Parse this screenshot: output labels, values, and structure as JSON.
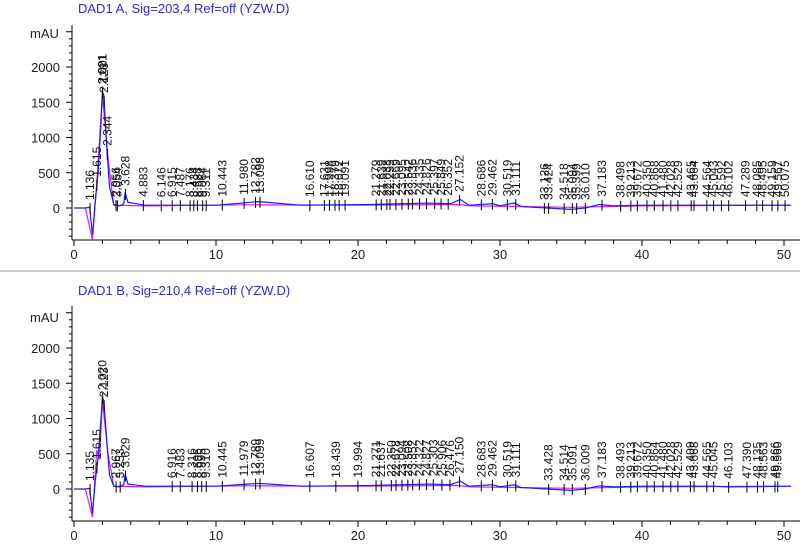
{
  "chart_data": [
    {
      "type": "line",
      "title": "DAD1 A, Sig=203,4 Ref=off (YZW.D)",
      "ylabel": "mAU",
      "xlabel": "",
      "xlim": [
        0,
        50.5
      ],
      "ylim": [
        -500,
        2700
      ],
      "x_ticks": [
        0,
        10,
        20,
        30,
        40,
        50
      ],
      "y_ticks": [
        0,
        500,
        1000,
        1500,
        2000
      ],
      "colors": {
        "signal": "#1a1aff",
        "baseline": "#e020e0"
      },
      "series": [
        {
          "name": "signal",
          "points": [
            [
              0,
              0
            ],
            [
              0.8,
              0
            ],
            [
              1.1,
              10
            ],
            [
              1.3,
              -380
            ],
            [
              1.5,
              100
            ],
            [
              1.7,
              500
            ],
            [
              1.9,
              1200
            ],
            [
              2.0,
              1650
            ],
            [
              2.1,
              1600
            ],
            [
              2.3,
              900
            ],
            [
              2.5,
              300
            ],
            [
              2.8,
              50
            ],
            [
              3.2,
              30
            ],
            [
              3.5,
              60
            ],
            [
              3.6,
              220
            ],
            [
              3.8,
              80
            ],
            [
              5,
              40
            ],
            [
              10,
              40
            ],
            [
              13,
              90
            ],
            [
              16,
              40
            ],
            [
              21,
              50
            ],
            [
              25,
              70
            ],
            [
              26.5,
              60
            ],
            [
              27.2,
              120
            ],
            [
              27.8,
              40
            ],
            [
              29.5,
              60
            ],
            [
              30,
              30
            ],
            [
              31,
              70
            ],
            [
              31.5,
              20
            ],
            [
              35,
              -20
            ],
            [
              36,
              0
            ],
            [
              37,
              50
            ],
            [
              38,
              30
            ],
            [
              40,
              40
            ],
            [
              50.5,
              40
            ]
          ]
        },
        {
          "name": "baseline",
          "points": [
            [
              0.8,
              0
            ],
            [
              1.3,
              -450
            ],
            [
              1.6,
              350
            ],
            [
              2.0,
              1600
            ],
            [
              2.4,
              700
            ],
            [
              2.8,
              40
            ],
            [
              5,
              30
            ],
            [
              12,
              45
            ],
            [
              20,
              40
            ],
            [
              27,
              50
            ],
            [
              28,
              30
            ],
            [
              35,
              10
            ],
            [
              40,
              30
            ],
            [
              50.5,
              40
            ]
          ]
        }
      ],
      "peak_labels": [
        "1.136",
        "1.615",
        "2.001",
        "2.021",
        "2.123",
        "2.344",
        "2.956",
        "3.054",
        "3.628",
        "4.883",
        "6.146",
        "6.915",
        "7.487",
        "8.176",
        "8.434",
        "8.688",
        "9.064",
        "9.311",
        "10.443",
        "11.980",
        "12.782",
        "13.098",
        "16.610",
        "17.631",
        "17.998",
        "18.379",
        "18.672",
        "19.091",
        "21.279",
        "21.639",
        "22.033",
        "22.255",
        "22.669",
        "23.095",
        "23.542",
        "23.836",
        "24.335",
        "24.826",
        "25.397",
        "25.849",
        "26.352",
        "27.152",
        "28.686",
        "29.462",
        "30.519",
        "31.111",
        "33.126",
        "33.424",
        "34.518",
        "35.094",
        "35.399",
        "36.010",
        "37.183",
        "38.498",
        "39.213",
        "39.672",
        "40.350",
        "40.868",
        "41.480",
        "42.028",
        "42.529",
        "43.465",
        "43.664",
        "44.564",
        "45.043",
        "45.592",
        "46.102",
        "47.289",
        "48.085",
        "48.495",
        "49.159",
        "49.567",
        "50.075"
      ]
    },
    {
      "type": "line",
      "title": "DAD1 B, Sig=210,4 Ref=off (YZW.D)",
      "ylabel": "mAU",
      "xlabel": "",
      "xlim": [
        0,
        50.5
      ],
      "ylim": [
        -500,
        2700
      ],
      "x_ticks": [
        0,
        10,
        20,
        30,
        40,
        50
      ],
      "y_ticks": [
        0,
        500,
        1000,
        1500,
        2000
      ],
      "colors": {
        "signal": "#1a1aff",
        "baseline": "#e020e0"
      },
      "series": [
        {
          "name": "signal",
          "points": [
            [
              0,
              0
            ],
            [
              0.8,
              0
            ],
            [
              1.1,
              10
            ],
            [
              1.3,
              -350
            ],
            [
              1.5,
              120
            ],
            [
              1.7,
              450
            ],
            [
              1.9,
              1000
            ],
            [
              2.0,
              1300
            ],
            [
              2.1,
              1250
            ],
            [
              2.3,
              700
            ],
            [
              2.5,
              200
            ],
            [
              2.8,
              40
            ],
            [
              3.2,
              30
            ],
            [
              3.5,
              60
            ],
            [
              3.6,
              210
            ],
            [
              3.8,
              70
            ],
            [
              5,
              40
            ],
            [
              10,
              40
            ],
            [
              13,
              80
            ],
            [
              16,
              40
            ],
            [
              21,
              50
            ],
            [
              25,
              70
            ],
            [
              26.5,
              60
            ],
            [
              27.2,
              110
            ],
            [
              27.8,
              40
            ],
            [
              29.5,
              60
            ],
            [
              30,
              30
            ],
            [
              31,
              60
            ],
            [
              31.5,
              20
            ],
            [
              35,
              -20
            ],
            [
              36,
              0
            ],
            [
              37,
              45
            ],
            [
              38,
              30
            ],
            [
              40,
              40
            ],
            [
              45,
              40
            ],
            [
              46,
              30
            ],
            [
              50.5,
              40
            ]
          ]
        },
        {
          "name": "baseline",
          "points": [
            [
              0.8,
              0
            ],
            [
              1.3,
              -400
            ],
            [
              1.6,
              550
            ],
            [
              1.8,
              420
            ],
            [
              2.0,
              1250
            ],
            [
              2.4,
              500
            ],
            [
              2.8,
              40
            ],
            [
              5,
              30
            ],
            [
              12,
              45
            ],
            [
              20,
              40
            ],
            [
              27,
              50
            ],
            [
              28,
              30
            ],
            [
              35,
              10
            ],
            [
              40,
              30
            ],
            [
              50.5,
              40
            ]
          ]
        }
      ],
      "peak_labels": [
        "1.135",
        "1.615",
        "2.020",
        "2.123",
        "2.967",
        "3.253",
        "3.629",
        "6.916",
        "7.483",
        "8.316",
        "8.696",
        "8.995",
        "9.310",
        "10.445",
        "11.979",
        "12.789",
        "13.099",
        "16.607",
        "18.439",
        "19.994",
        "21.271",
        "21.637",
        "22.350",
        "22.678",
        "23.094",
        "23.508",
        "23.852",
        "24.322",
        "24.827",
        "25.303",
        "25.906",
        "26.476",
        "27.150",
        "28.683",
        "29.462",
        "30.519",
        "31.111",
        "33.428",
        "34.514",
        "35.091",
        "36.009",
        "37.183",
        "38.493",
        "39.213",
        "39.672",
        "40.350",
        "40.864",
        "41.480",
        "42.028",
        "42.529",
        "43.409",
        "43.668",
        "44.565",
        "45.045",
        "46.103",
        "47.390",
        "48.135",
        "48.563",
        "49.366",
        "49.560"
      ]
    }
  ]
}
